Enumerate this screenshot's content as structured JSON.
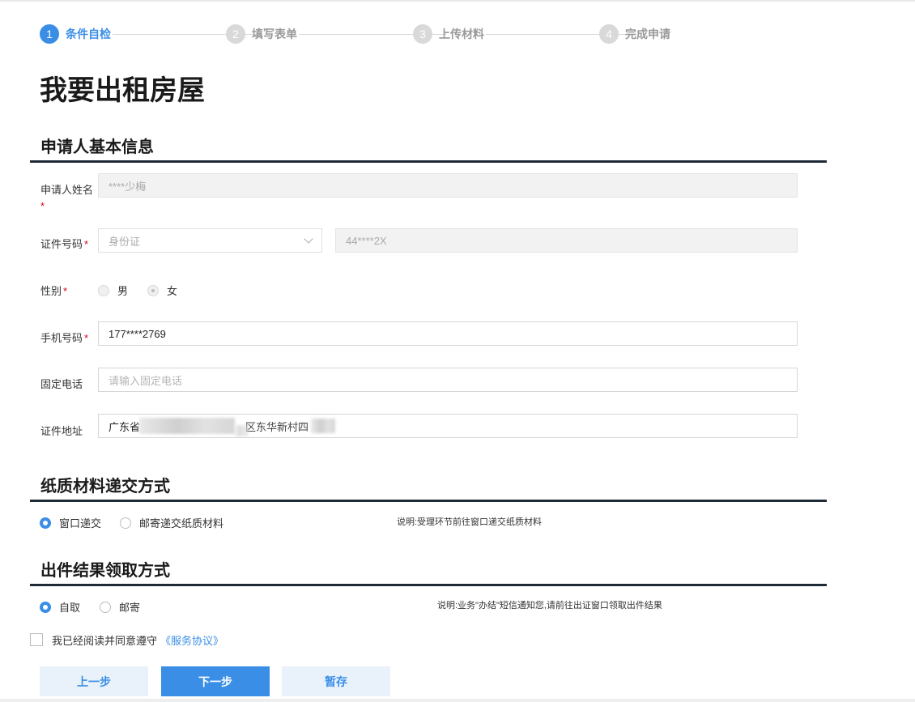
{
  "steps": [
    {
      "num": "1",
      "label": "条件自检"
    },
    {
      "num": "2",
      "label": "填写表单"
    },
    {
      "num": "3",
      "label": "上传材料"
    },
    {
      "num": "4",
      "label": "完成申请"
    }
  ],
  "page_title": "我要出租房屋",
  "applicant": {
    "section_title": "申请人基本信息",
    "name_label": "申请人姓名",
    "name_value": "****少梅",
    "id_label": "证件号码",
    "id_type": "身份证",
    "id_value": "44****2X",
    "gender_label": "性别",
    "gender_male": "男",
    "gender_female": "女",
    "mobile_label": "手机号码",
    "mobile_value": "177****2769",
    "phone_label": "固定电话",
    "phone_placeholder": "请输入固定电话",
    "address_label": "证件地址",
    "address_value": "广东省",
    "address_suffix": "区东华新村四"
  },
  "paper": {
    "section_title": "纸质材料递交方式",
    "option_window": "窗口递交",
    "option_mail": "邮寄递交纸质材料",
    "note": "说明:受理环节前往窗口递交纸质材料"
  },
  "result": {
    "section_title": "出件结果领取方式",
    "option_self": "自取",
    "option_mail": "邮寄",
    "note": "说明:业务\"办结\"短信通知您,请前往出证窗口领取出件结果"
  },
  "agreement": {
    "text": "我已经阅读并同意遵守",
    "link": "《服务协议》"
  },
  "buttons": {
    "prev": "上一步",
    "next": "下一步",
    "save": "暂存"
  },
  "required_mark": "*",
  "colors": {
    "accent": "#3a8ee6",
    "required": "#d9001b",
    "rule": "#1e2a35"
  }
}
